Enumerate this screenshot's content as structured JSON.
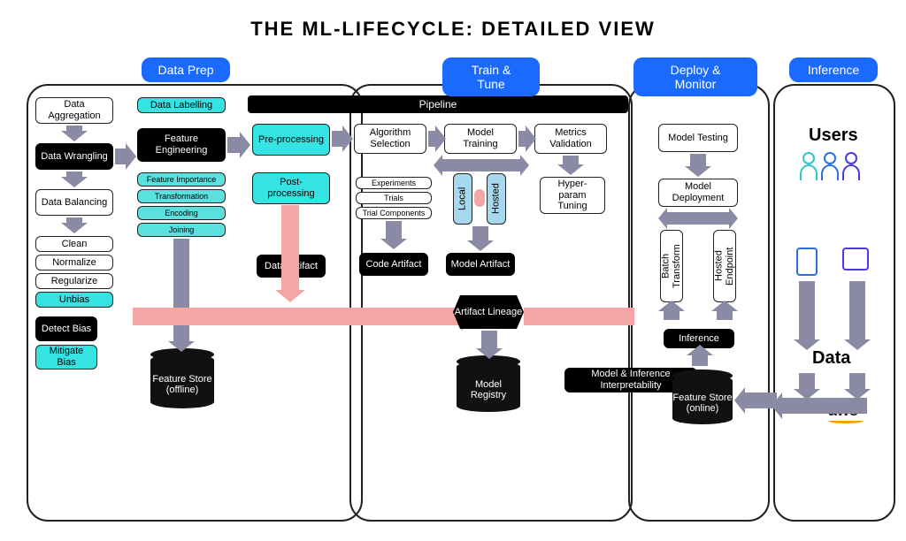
{
  "title": "THE ML-LIFECYCLE: DETAILED VIEW",
  "phases": {
    "data_prep": "Data Prep",
    "train_tune": "Train & Tune",
    "deploy_monitor": "Deploy & Monitor",
    "inference": "Inference"
  },
  "pipeline_label": "Pipeline",
  "dataprep": {
    "data_aggregation": "Data Aggregation",
    "data_wrangling": "Data Wrangling",
    "data_balancing": "Data Balancing",
    "clean": "Clean",
    "normalize": "Normalize",
    "regularize": "Regularize",
    "unbias": "Unbias",
    "detect_bias": "Detect Bias",
    "mitigate_bias": "Mitigate Bias",
    "data_labelling": "Data Labelling",
    "feature_engineering": "Feature Engineering",
    "feature_importance": "Feature Importance",
    "transformation": "Transformation",
    "encoding": "Encoding",
    "joining": "Joining",
    "feature_store_offline": "Feature Store (offline)"
  },
  "processing": {
    "pre": "Pre-processing",
    "post": "Post-processing",
    "data_artifact": "Data Artifact"
  },
  "train": {
    "algorithm_selection": "Algorithm Selection",
    "model_training": "Model Training",
    "metrics_validation": "Metrics Validation",
    "experiments": "Experiments",
    "trials": "Trials",
    "trial_components": "Trial Components",
    "local": "Local",
    "hosted": "Hosted",
    "hyperparam_tuning": "Hyper-param Tuning",
    "code_artifact": "Code Artifact",
    "model_artifact": "Model Artifact",
    "artifact_lineage": "Artifact Lineage",
    "model_registry": "Model Registry"
  },
  "deploy": {
    "model_testing": "Model Testing",
    "model_deployment": "Model Deployment",
    "batch_transform": "Batch Transform",
    "hosted_endpoint": "Hosted Endpoint",
    "inference": "Inference",
    "interpretability": "Model & Inference Interpretability",
    "feature_store_online": "Feature Store (online)"
  },
  "inference": {
    "users": "Users",
    "data": "Data",
    "aws": "aws"
  }
}
